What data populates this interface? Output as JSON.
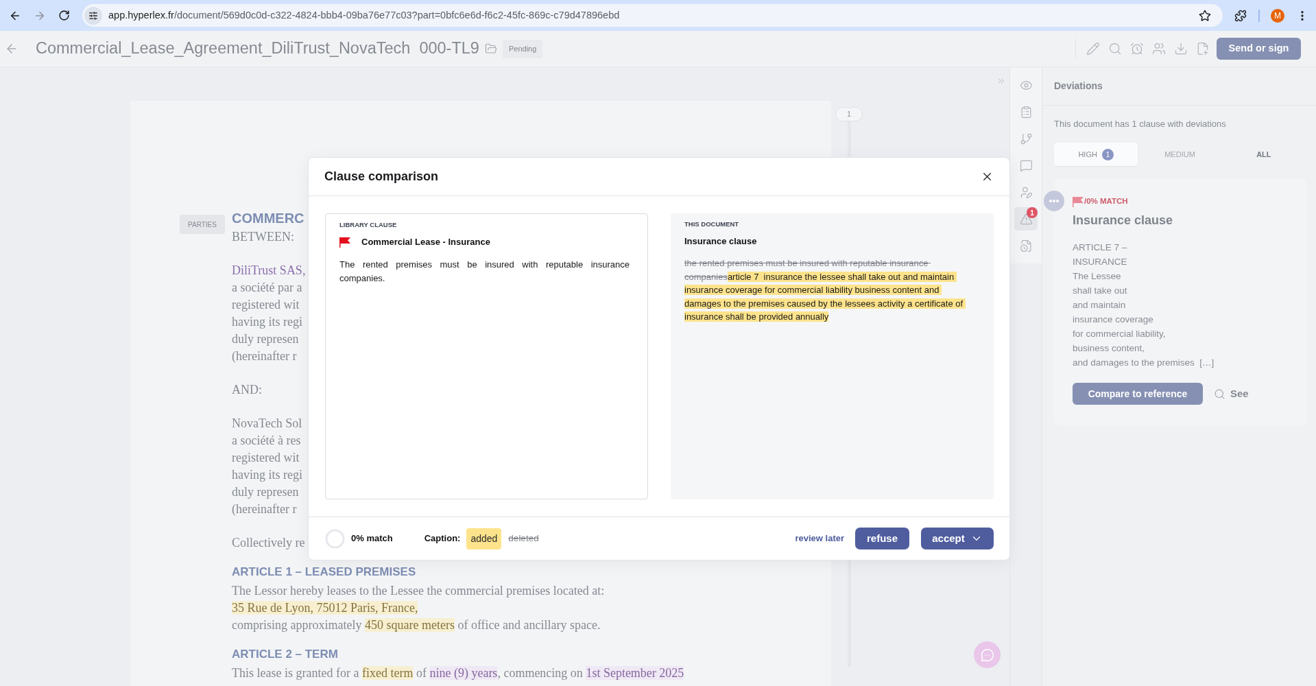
{
  "browser": {
    "url_host": "app.hyperlex.fr",
    "url_path": "/document/569d0c0d-c322-4824-bbb4-09ba76e77c03?part=0bfc6e6d-f6c2-45fc-869c-c79d47896ebd",
    "profile_initial": "M"
  },
  "header": {
    "title": "Commercial_Lease_Agreement_DiliTrust_NovaTech",
    "reference": "000-TL9",
    "status": "Pending",
    "primary_action": "Send or sign"
  },
  "document": {
    "page_number": "1",
    "paragraphs": [
      {
        "kind": "title",
        "tag": "PARTIES",
        "lines": [
          [
            {
              "kind": "plain",
              "text": "COMMERC"
            }
          ]
        ]
      },
      {
        "kind": "text",
        "lines": [
          [
            {
              "kind": "plain",
              "text": "BETWEEN:"
            }
          ]
        ]
      },
      {
        "kind": "text",
        "lines": [
          [
            {
              "kind": "party",
              "text": "DiliTrust SAS,"
            }
          ],
          [
            {
              "kind": "plain",
              "text": "a société par a"
            }
          ],
          [
            {
              "kind": "plain",
              "text": "registered wit"
            }
          ],
          [
            {
              "kind": "plain",
              "text": "having its regi"
            }
          ],
          [
            {
              "kind": "plain",
              "text": "duly represen"
            }
          ],
          [
            {
              "kind": "plain",
              "text": "(hereinafter r"
            }
          ]
        ]
      },
      {
        "kind": "text",
        "lines": [
          [
            {
              "kind": "plain",
              "text": "AND:"
            }
          ]
        ]
      },
      {
        "kind": "text",
        "lines": [
          [
            {
              "kind": "plain",
              "text": "NovaTech Sol"
            }
          ],
          [
            {
              "kind": "plain",
              "text": "a société à res"
            }
          ],
          [
            {
              "kind": "plain",
              "text": "registered wit"
            }
          ],
          [
            {
              "kind": "plain",
              "text": "having its regi"
            }
          ],
          [
            {
              "kind": "plain",
              "text": "duly represen"
            }
          ],
          [
            {
              "kind": "plain",
              "text": "(hereinafter r"
            }
          ]
        ]
      },
      {
        "kind": "text",
        "lines": [
          [
            {
              "kind": "plain",
              "text": "Collectively re"
            }
          ]
        ]
      },
      {
        "kind": "heading",
        "lines": [
          [
            {
              "kind": "plain",
              "text": "ARTICLE 1 – LEASED PREMISES"
            }
          ]
        ]
      },
      {
        "kind": "text",
        "lines": [
          [
            {
              "kind": "plain",
              "text": "The Lessor hereby leases to the Lessee the commercial premises located at:"
            }
          ],
          [
            {
              "kind": "highlight",
              "text": "35 Rue de Lyon, 75012 Paris, France,"
            }
          ],
          [
            {
              "kind": "plain",
              "text": "comprising approximately "
            },
            {
              "kind": "highlight",
              "text": "450 square meters"
            },
            {
              "kind": "plain",
              "text": " of office and ancillary space."
            }
          ]
        ]
      },
      {
        "kind": "heading",
        "lines": [
          [
            {
              "kind": "plain",
              "text": "ARTICLE 2 – TERM"
            }
          ]
        ]
      },
      {
        "kind": "text",
        "lines": [
          [
            {
              "kind": "plain",
              "text": "This lease is granted for a "
            },
            {
              "kind": "highlight",
              "text": "fixed term"
            },
            {
              "kind": "plain",
              "text": " of "
            },
            {
              "kind": "entity",
              "text": "nine (9) years"
            },
            {
              "kind": "plain",
              "text": ", commencing on "
            },
            {
              "kind": "entity",
              "text": "1st September 2025"
            }
          ]
        ]
      }
    ]
  },
  "rail": {
    "items": [
      {
        "kind": "eye",
        "selected": false
      },
      {
        "kind": "clipboard",
        "selected": false
      },
      {
        "kind": "branch",
        "selected": false
      },
      {
        "kind": "comment",
        "selected": false
      },
      {
        "kind": "signer",
        "selected": false
      },
      {
        "kind": "warning",
        "selected": true,
        "badge": "1"
      },
      {
        "kind": "history",
        "selected": false
      }
    ]
  },
  "sidebar": {
    "title": "Deviations",
    "summary": "This document has 1 clause with deviations",
    "tabs": [
      {
        "label": "HIGH",
        "count": "1",
        "selected": true,
        "disabled": false
      },
      {
        "label": "MEDIUM",
        "selected": false,
        "disabled": true
      },
      {
        "label": "ALL",
        "selected": false,
        "disabled": false
      }
    ],
    "deviation": {
      "match": "/0% MATCH",
      "title": "Insurance clause",
      "excerpt_lines": [
        "ARTICLE 7 –",
        "INSURANCE",
        "The Lessee",
        "shall take out",
        "and maintain",
        "insurance coverage",
        "for commercial liability,",
        "business content,",
        "and damages to the premises  […]"
      ],
      "compare_button": "Compare to reference",
      "see_link": "See"
    }
  },
  "modal": {
    "title": "Clause comparison",
    "panels": [
      {
        "kind": "library",
        "heading": "LIBRARY CLAUSE",
        "title": "Commercial Lease - Insurance",
        "flagged": true,
        "body": [
          {
            "kind": "plain",
            "text": "The rented premises must be insured with reputable insurance companies."
          }
        ]
      },
      {
        "kind": "document",
        "heading": "THIS DOCUMENT",
        "title": "Insurance clause",
        "flagged": false,
        "body": [
          {
            "kind": "deleted",
            "text": "the rented premises must be insured with reputable insurance companies"
          },
          {
            "kind": "added",
            "text": "article 7  insurance the lessee shall take out and maintain insurance coverage for commercial liability business content and damages to the premises caused by the lessees activity a certificate of insurance shall be provided annually"
          }
        ]
      }
    ],
    "match": {
      "label": "0% match",
      "level": 0
    },
    "caption": {
      "label": "Caption:",
      "items": [
        {
          "kind": "added",
          "text": "added"
        },
        {
          "kind": "deleted",
          "text": "deleted"
        }
      ]
    },
    "actions": {
      "review_later": "review later",
      "refuse": "refuse",
      "accept": "accept"
    }
  }
}
